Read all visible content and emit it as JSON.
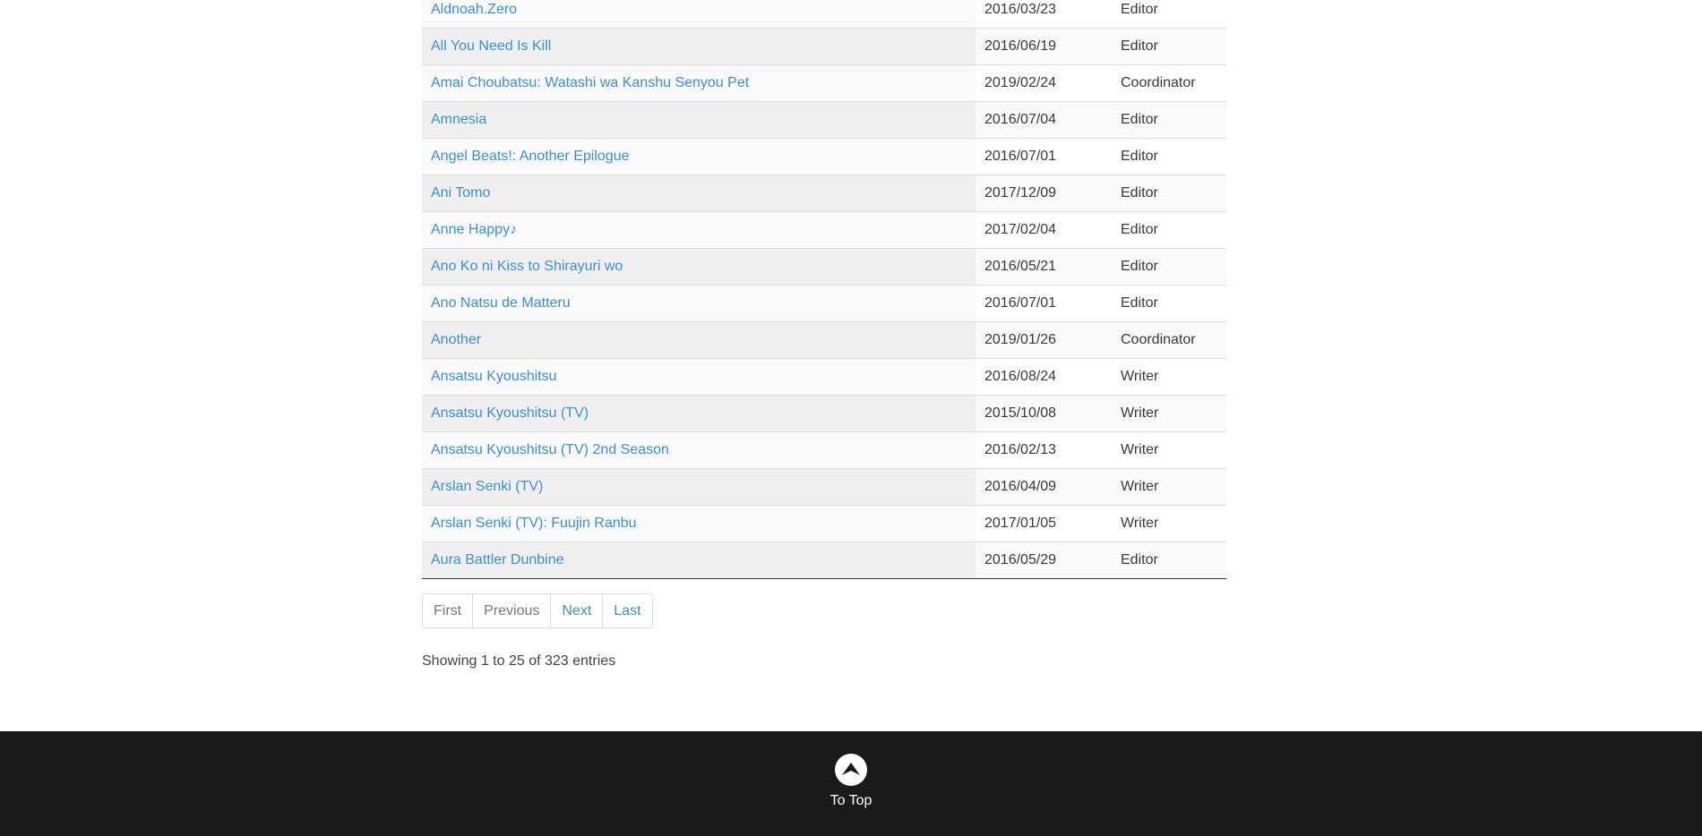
{
  "table": {
    "rows": [
      {
        "title": "Aldnoah.Zero",
        "date": "2016/03/23",
        "role": "Editor"
      },
      {
        "title": "All You Need Is Kill",
        "date": "2016/06/19",
        "role": "Editor"
      },
      {
        "title": "Amai Choubatsu: Watashi wa Kanshu Senyou Pet",
        "date": "2019/02/24",
        "role": "Coordinator"
      },
      {
        "title": "Amnesia",
        "date": "2016/07/04",
        "role": "Editor"
      },
      {
        "title": "Angel Beats!: Another Epilogue",
        "date": "2016/07/01",
        "role": "Editor"
      },
      {
        "title": "Ani Tomo",
        "date": "2017/12/09",
        "role": "Editor"
      },
      {
        "title": "Anne Happy♪",
        "date": "2017/02/04",
        "role": "Editor"
      },
      {
        "title": "Ano Ko ni Kiss to Shirayuri wo",
        "date": "2016/05/21",
        "role": "Editor"
      },
      {
        "title": "Ano Natsu de Matteru",
        "date": "2016/07/01",
        "role": "Editor"
      },
      {
        "title": "Another",
        "date": "2019/01/26",
        "role": "Coordinator"
      },
      {
        "title": "Ansatsu Kyoushitsu",
        "date": "2016/08/24",
        "role": "Writer"
      },
      {
        "title": "Ansatsu Kyoushitsu (TV)",
        "date": "2015/10/08",
        "role": "Writer"
      },
      {
        "title": "Ansatsu Kyoushitsu (TV) 2nd Season",
        "date": "2016/02/13",
        "role": "Writer"
      },
      {
        "title": "Arslan Senki (TV)",
        "date": "2016/04/09",
        "role": "Writer"
      },
      {
        "title": "Arslan Senki (TV): Fuujin Ranbu",
        "date": "2017/01/05",
        "role": "Writer"
      },
      {
        "title": "Aura Battler Dunbine",
        "date": "2016/05/29",
        "role": "Editor"
      }
    ]
  },
  "pagination": {
    "first": "First",
    "previous": "Previous",
    "next": "Next",
    "last": "Last"
  },
  "info": "Showing 1 to 25 of 323 entries",
  "footer": {
    "to_top_label": "To Top",
    "to_top_icon": "chevron-up-icon"
  }
}
